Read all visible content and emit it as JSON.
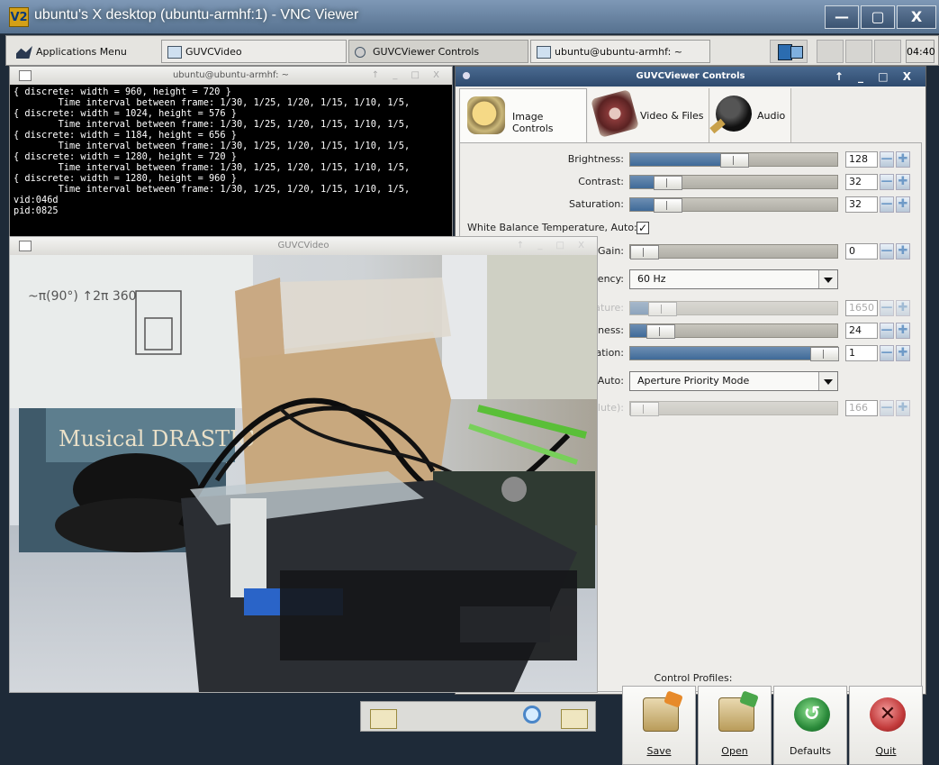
{
  "vnc": {
    "logo": "V2",
    "title": "ubuntu's X desktop (ubuntu-armhf:1) - VNC Viewer",
    "min": "—",
    "max": "▢",
    "close": "X"
  },
  "taskbar": {
    "apps": "Applications Menu",
    "tasks": [
      "GUVCVideo",
      "GUVCViewer Controls",
      "ubuntu@ubuntu-armhf: ~"
    ],
    "clock": "04:40"
  },
  "terminal": {
    "title": "ubuntu@ubuntu-armhf: ~",
    "buttons": "↑ _ □ X",
    "lines": "{ discrete: width = 960, height = 720 }\n        Time interval between frame: 1/30, 1/25, 1/20, 1/15, 1/10, 1/5,\n{ discrete: width = 1024, height = 576 }\n        Time interval between frame: 1/30, 1/25, 1/20, 1/15, 1/10, 1/5,\n{ discrete: width = 1184, height = 656 }\n        Time interval between frame: 1/30, 1/25, 1/20, 1/15, 1/10, 1/5,\n{ discrete: width = 1280, height = 720 }\n        Time interval between frame: 1/30, 1/25, 1/20, 1/15, 1/10, 1/5,\n{ discrete: width = 1280, height = 960 }\n        Time interval between frame: 1/30, 1/25, 1/20, 1/15, 1/10, 1/5,\nvid:046d\npid:0825"
  },
  "controls": {
    "title": "GUVCViewer Controls",
    "buttons": "↑ _ □ X",
    "tabs": [
      "Image Controls",
      "Video & Files",
      "Audio"
    ],
    "brightness": {
      "label": "Brightness:",
      "value": "128",
      "level": 0.5
    },
    "contrast": {
      "label": "Contrast:",
      "value": "32",
      "level": 0.13
    },
    "saturation": {
      "label": "Saturation:",
      "value": "32",
      "level": 0.13
    },
    "wb_auto": {
      "label": "White Balance Temperature, Auto:",
      "checked": "✓"
    },
    "gain": {
      "label": "Gain:",
      "value": "0",
      "level": 0.0
    },
    "powerline": {
      "label": "ency:",
      "value": "60 Hz"
    },
    "wb_temp": {
      "label": "ature:",
      "value": "1650",
      "level": 0.1
    },
    "sharpness": {
      "label": "ness:",
      "value": "24",
      "level": 0.09
    },
    "backlight": {
      "label": "ation:",
      "value": "1",
      "level": 1.0
    },
    "exposure_auto": {
      "label": "Auto:",
      "value": "Aperture Priority Mode"
    },
    "exposure_abs": {
      "label": "olute):",
      "value": "166",
      "level": 0.0
    },
    "spin_minus": "—",
    "spin_plus": "✚",
    "profiles": {
      "label": "Control Profiles:",
      "buttons": [
        "Save",
        "Open",
        "Defaults",
        "Quit"
      ]
    }
  },
  "video": {
    "title": "GUVCVideo",
    "buttons": "↑ _ □ X",
    "scene_text": {
      "book": "Musical DRASTIC",
      "whiteboard": "~π(90°) ↑2π 360"
    }
  }
}
